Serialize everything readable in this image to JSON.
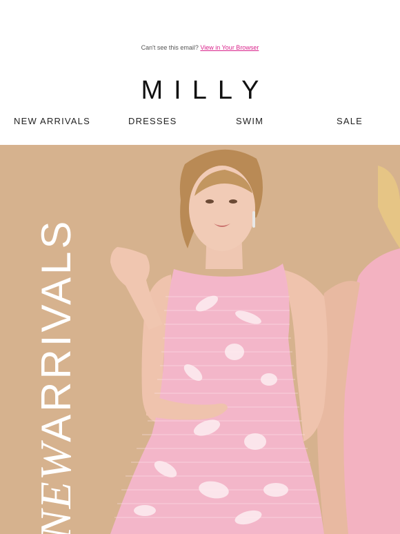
{
  "preheader": {
    "text": "Can't see this email?",
    "link": "View in Your Browser"
  },
  "brand": {
    "logo": "MILLY"
  },
  "nav": {
    "items": [
      {
        "label": "NEW ARRIVALS"
      },
      {
        "label": "DRESSES"
      },
      {
        "label": "SWIM"
      },
      {
        "label": "SALE"
      }
    ]
  },
  "hero": {
    "headline_italic": "NEW",
    "headline": "ARRIVALS",
    "background_color": "#d6b28e",
    "dress_color": "#f3b6c9"
  }
}
